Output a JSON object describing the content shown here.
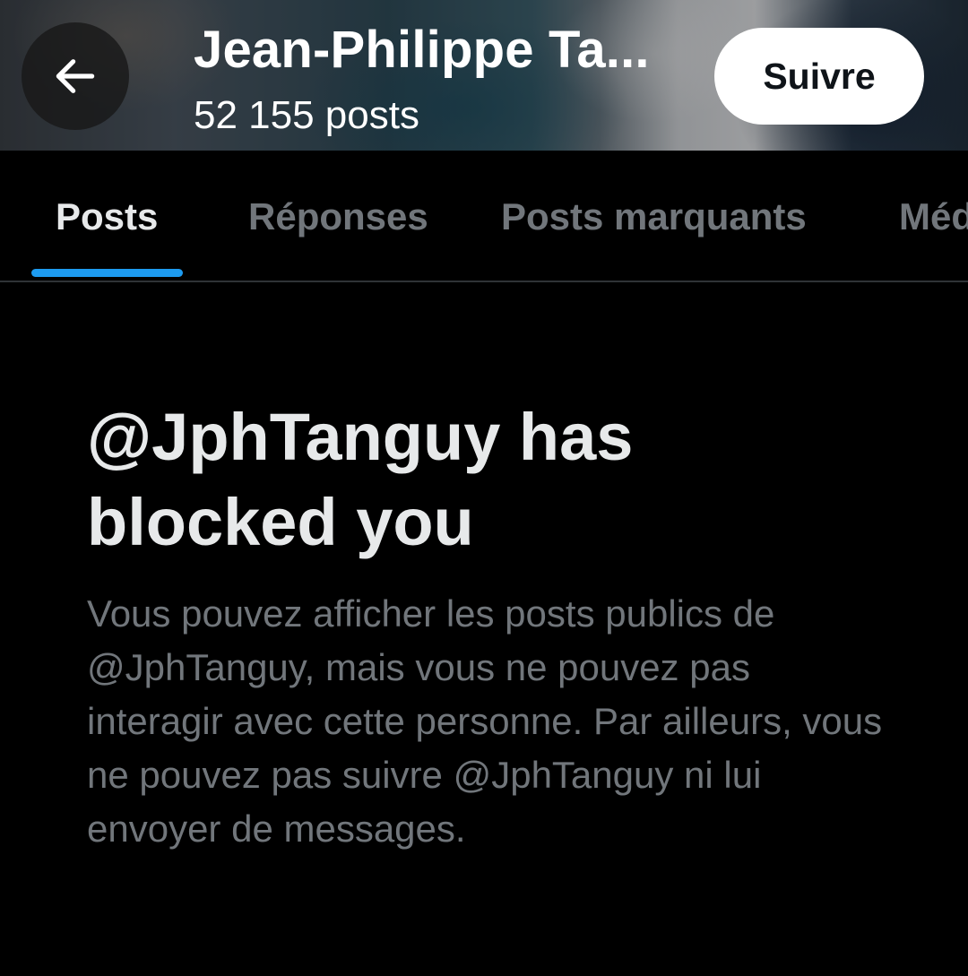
{
  "header": {
    "name": "Jean-Philippe Ta...",
    "post_count": "52 155 posts",
    "follow_label": "Suivre"
  },
  "tabs": [
    {
      "label": "Posts",
      "active": true
    },
    {
      "label": "Réponses",
      "active": false
    },
    {
      "label": "Posts marquants",
      "active": false
    },
    {
      "label": "Méd",
      "active": false
    }
  ],
  "blocked": {
    "title": "@JphTanguy has blocked you",
    "description": "Vous pouvez afficher les posts publics de @JphTanguy, mais vous ne pouvez pas interagir avec cette personne. Par ailleurs, vous ne pouvez pas suivre @JphTanguy ni lui envoyer de messages."
  },
  "icons": {
    "back": "arrow-left-icon"
  },
  "colors": {
    "background": "#000000",
    "primary_text": "#e7e9ea",
    "secondary_text": "#71767b",
    "accent": "#1d9bf0",
    "divider": "#2f3336"
  }
}
